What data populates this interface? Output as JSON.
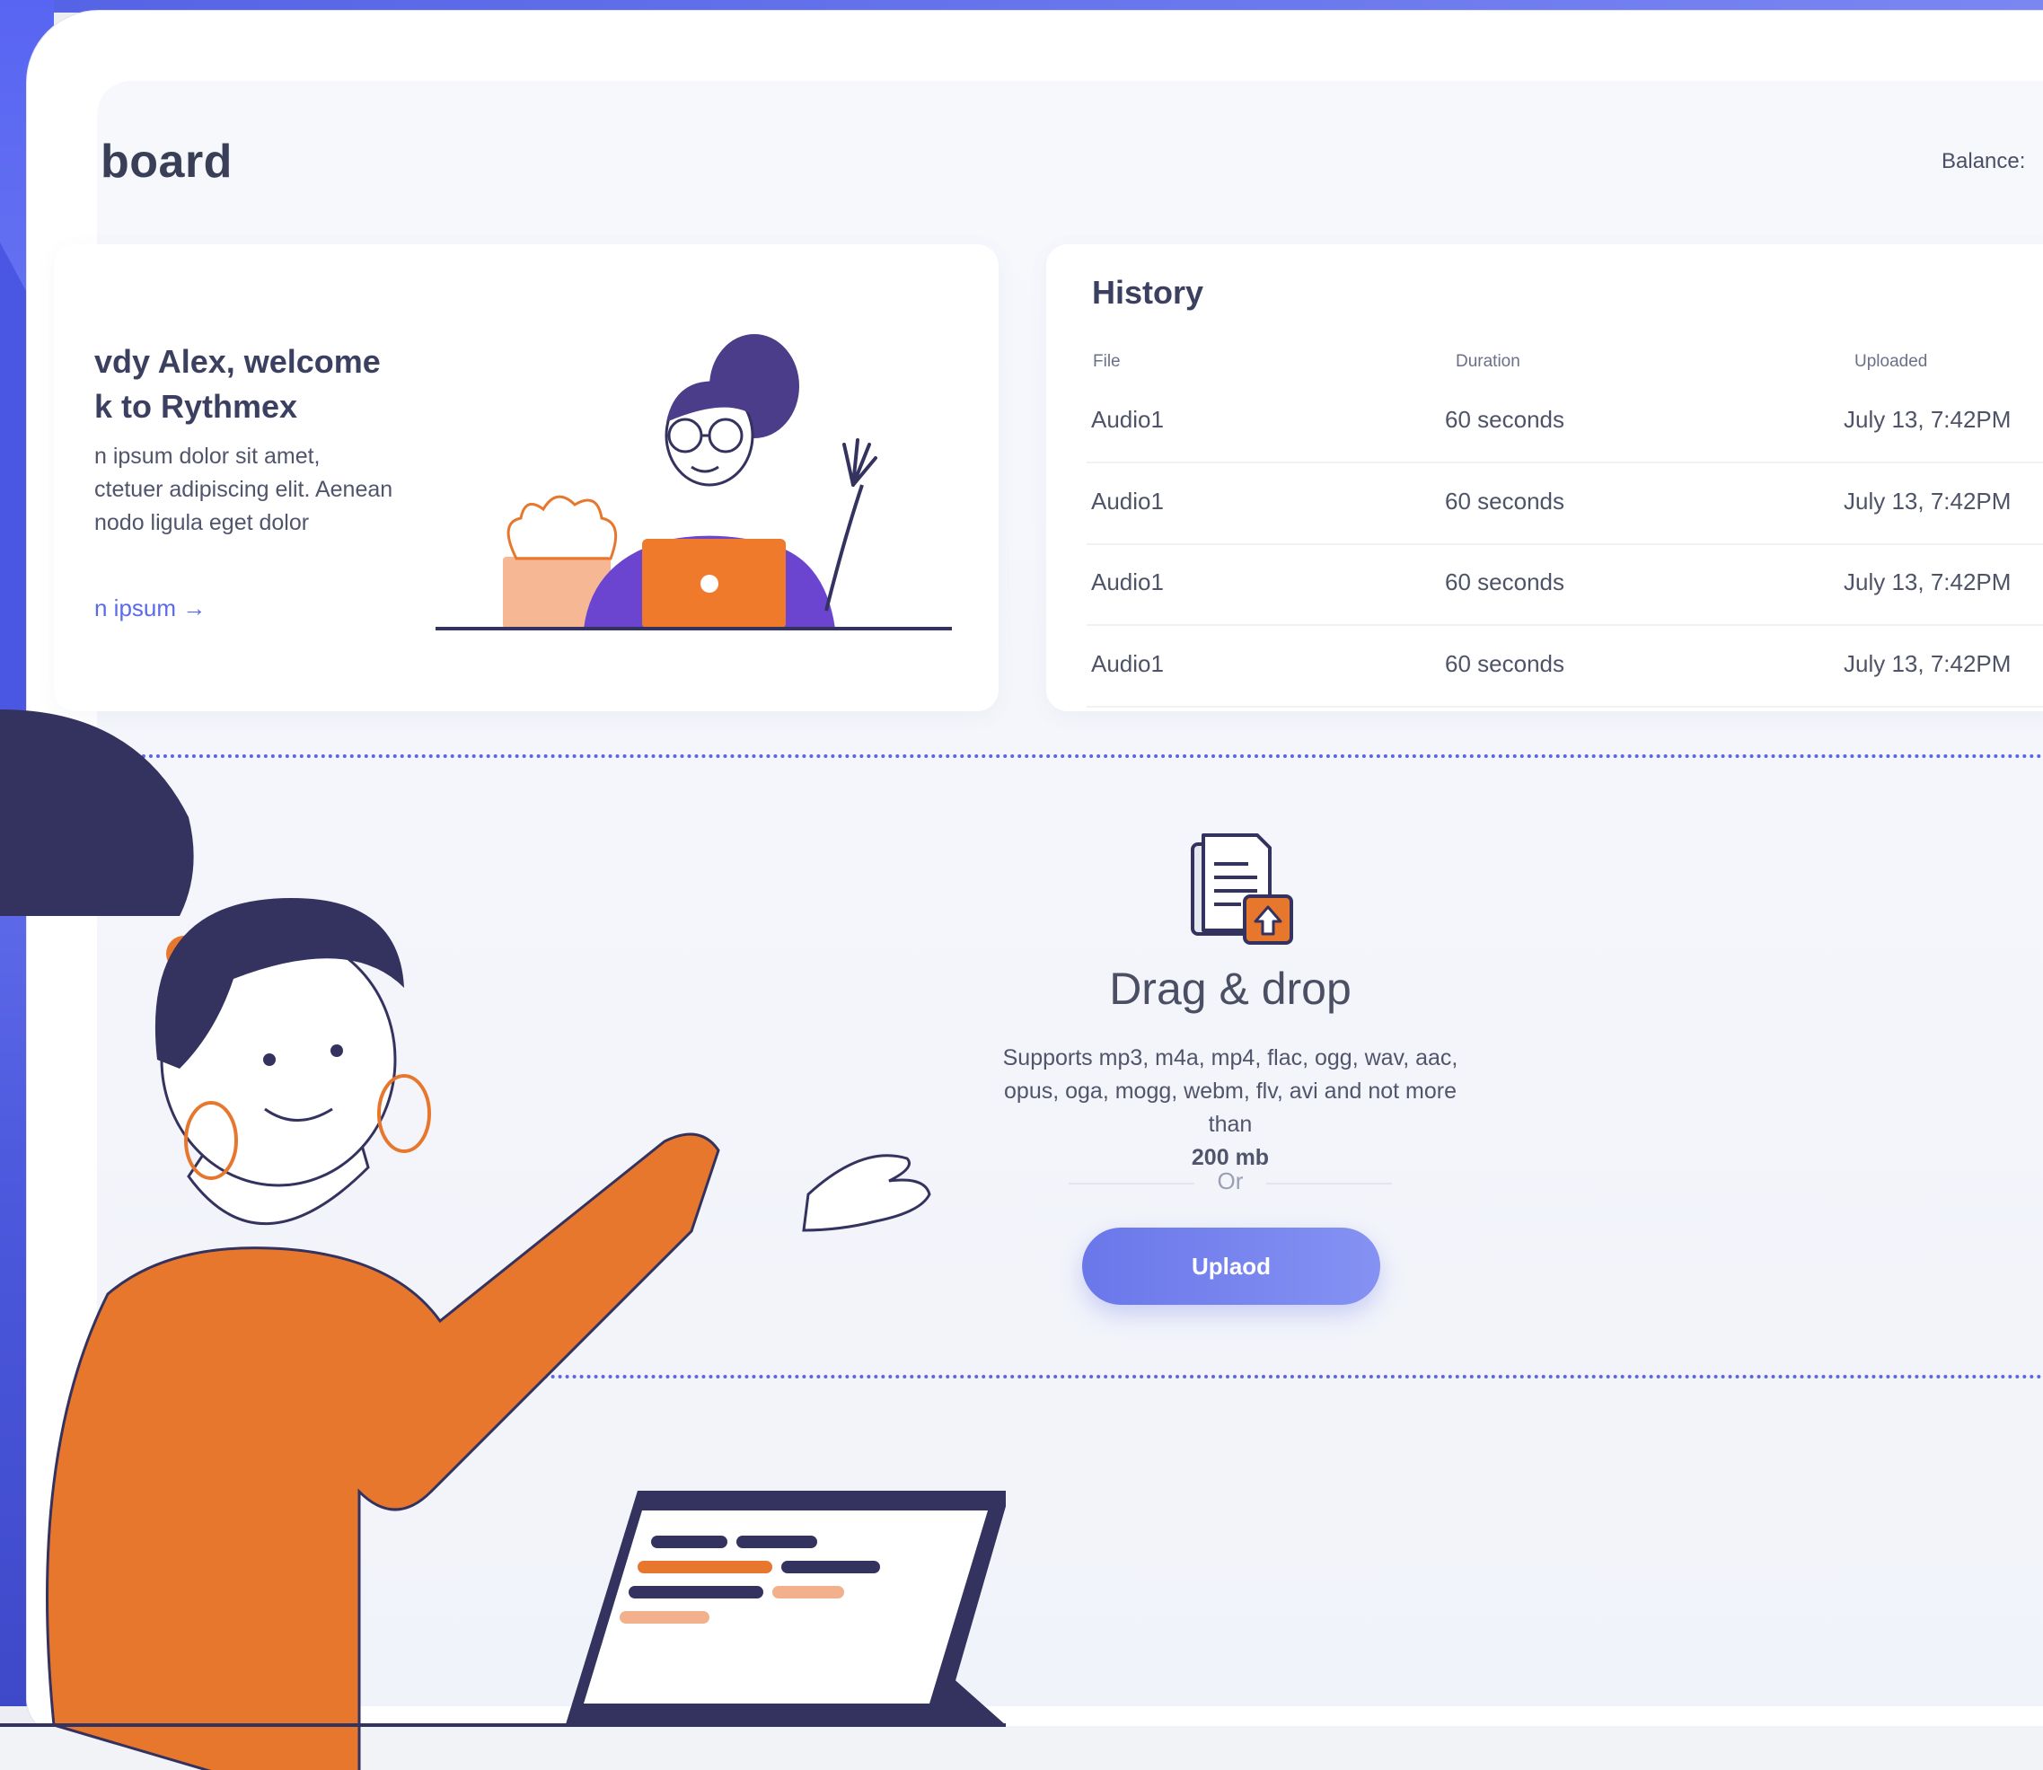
{
  "header": {
    "title": "board",
    "balance_label": "Balance: "
  },
  "welcome": {
    "heading_line1": "vdy Alex, welcome",
    "heading_line2": "k to Rythmex",
    "body_line1": "n ipsum dolor sit amet,",
    "body_line2": "ctetuer adipiscing elit. Aenean",
    "body_line3": "nodo ligula eget dolor",
    "link_label": "n ipsum →"
  },
  "history": {
    "title": "History",
    "columns": [
      "File",
      "Duration",
      "Uploaded"
    ],
    "rows": [
      {
        "file": "Audio1",
        "duration": "60 seconds",
        "uploaded": "July 13, 7:42PM"
      },
      {
        "file": "Audio1",
        "duration": "60 seconds",
        "uploaded": "July 13, 7:42PM"
      },
      {
        "file": "Audio1",
        "duration": "60 seconds",
        "uploaded": "July 13, 7:42PM"
      },
      {
        "file": "Audio1",
        "duration": "60 seconds",
        "uploaded": "July 13, 7:42PM"
      }
    ]
  },
  "upload": {
    "title": "Drag & drop",
    "supports_line1": "Supports mp3, m4a, mp4, flac, ogg, wav, aac,",
    "supports_line2": "opus, oga, mogg, webm, flv, avi and not more",
    "supports_line3_prefix": "than ",
    "supports_line3_bold": "200 mb",
    "or_label": "Or",
    "button_label": "Uplaod"
  },
  "colors": {
    "accent": "#6a77ea",
    "orange": "#e8772e",
    "navy": "#34325f",
    "purple": "#5a3fc0"
  }
}
